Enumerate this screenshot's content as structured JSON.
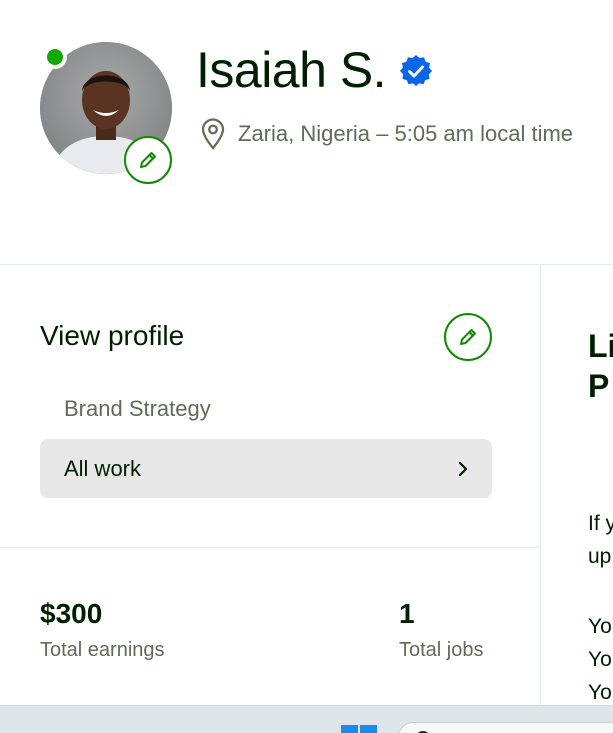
{
  "profile": {
    "name": "Isaiah S.",
    "location": "Zaria, Nigeria – 5:05 am local time",
    "online_status": "online"
  },
  "left_panel": {
    "title": "View profile",
    "specialty": "Brand Strategy",
    "all_work_label": "All work",
    "stats": [
      {
        "value": "$300",
        "label": "Total earnings"
      },
      {
        "value": "1",
        "label": "Total jobs"
      }
    ]
  },
  "right_panel": {
    "title_lines": [
      "Li",
      "P"
    ],
    "text_lines": [
      "If y",
      "up",
      "Yo",
      "Yo",
      "Yo"
    ]
  },
  "colors": {
    "brand_green": "#108a00",
    "online_green": "#14a800",
    "verified_blue": "#0a66e8",
    "text_primary": "#001e00",
    "text_secondary": "#5e6d55"
  },
  "icons": {
    "verified": "verified-badge-icon",
    "location": "map-pin-icon",
    "edit": "pencil-icon",
    "chevron": "chevron-right-icon"
  }
}
